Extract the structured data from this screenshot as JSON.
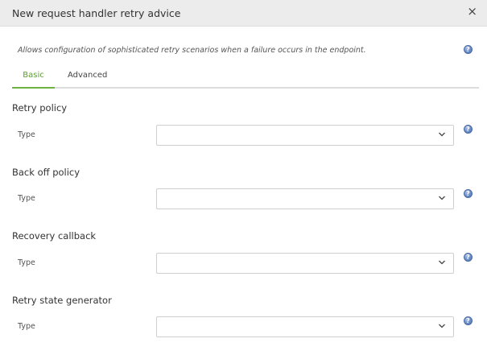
{
  "dialog": {
    "title": "New request handler retry advice",
    "close_glyph": "×",
    "description": "Allows configuration of sophisticated retry scenarios when a failure occurs in the endpoint.",
    "help_glyph": "?"
  },
  "tabs": [
    {
      "label": "Basic",
      "active": true
    },
    {
      "label": "Advanced",
      "active": false
    }
  ],
  "sections": [
    {
      "title": "Retry policy",
      "field_label": "Type",
      "value": ""
    },
    {
      "title": "Back off policy",
      "field_label": "Type",
      "value": ""
    },
    {
      "title": "Recovery callback",
      "field_label": "Type",
      "value": ""
    },
    {
      "title": "Retry state generator",
      "field_label": "Type",
      "value": ""
    }
  ],
  "colors": {
    "accent": "#6cb33f",
    "header_bg": "#ececec",
    "help_icon": "#6b8dc7"
  }
}
